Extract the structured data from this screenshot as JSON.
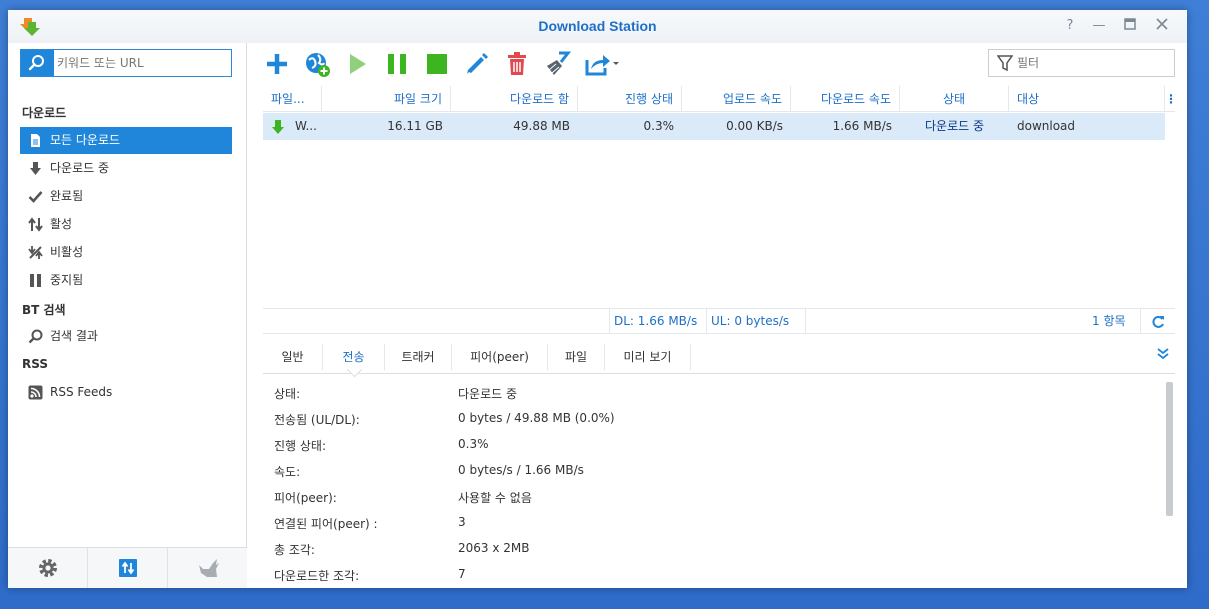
{
  "window": {
    "title": "Download Station"
  },
  "sidebar": {
    "search_placeholder": "키워드 또는 URL",
    "sections": {
      "download": "다운로드",
      "bt_search": "BT 검색",
      "rss": "RSS"
    },
    "items": [
      {
        "label": "모든 다운로드",
        "icon": "document-icon",
        "active": true
      },
      {
        "label": "다운로드 중",
        "icon": "arrow-down-icon"
      },
      {
        "label": "완료됨",
        "icon": "checkmark-icon"
      },
      {
        "label": "활성",
        "icon": "up-down-arrows-icon"
      },
      {
        "label": "비활성",
        "icon": "inactive-percent-icon"
      },
      {
        "label": "중지됨",
        "icon": "pause-icon"
      },
      {
        "label": "검색 결과",
        "icon": "search-icon"
      },
      {
        "label": "RSS Feeds",
        "icon": "rss-icon"
      }
    ]
  },
  "toolbar": {
    "buttons": [
      "add-icon",
      "add-url-icon",
      "play-icon",
      "pause-icon",
      "stop-icon",
      "edit-icon",
      "delete-icon",
      "clean-icon",
      "share-icon"
    ],
    "filter_placeholder": "필터"
  },
  "table": {
    "columns": [
      "파일...",
      "파일 크기",
      "다운로드 함",
      "진행 상태",
      "업로드 속도",
      "다운로드 속도",
      "상태",
      "대상"
    ],
    "rows": [
      {
        "name": "W...",
        "size": "16.11 GB",
        "downloaded": "49.88 MB",
        "progress": "0.3%",
        "upload_speed": "0.00 KB/s",
        "download_speed": "1.66 MB/s",
        "status": "다운로드 중",
        "destination": "download"
      }
    ]
  },
  "statusbar": {
    "dl": "DL:  1.66 MB/s",
    "ul": "UL:  0 bytes/s",
    "count": "1 항목"
  },
  "detail": {
    "tabs": [
      "일반",
      "전송",
      "트래커",
      "피어(peer)",
      "파일",
      "미리 보기"
    ],
    "active_tab": "전송",
    "rows": [
      {
        "label": "상태:",
        "value": "다운로드 중"
      },
      {
        "label": "전송됨 (UL/DL):",
        "value": "0 bytes / 49.88 MB (0.0%)"
      },
      {
        "label": "진행 상태:",
        "value": "0.3%"
      },
      {
        "label": "속도:",
        "value": "0 bytes/s / 1.66 MB/s"
      },
      {
        "label": "피어(peer):",
        "value": "사용할 수 없음"
      },
      {
        "label": "연결된 피어(peer) :",
        "value": "3"
      },
      {
        "label": "총 조각:",
        "value": "2063 x 2MB"
      },
      {
        "label": "다운로드한 조각:",
        "value": "7"
      }
    ]
  },
  "colors": {
    "accent": "#1f86d9",
    "title": "#1e6fc8",
    "selected_row": "#dbeaf8",
    "green": "#3cb521",
    "red": "#e2484f"
  }
}
